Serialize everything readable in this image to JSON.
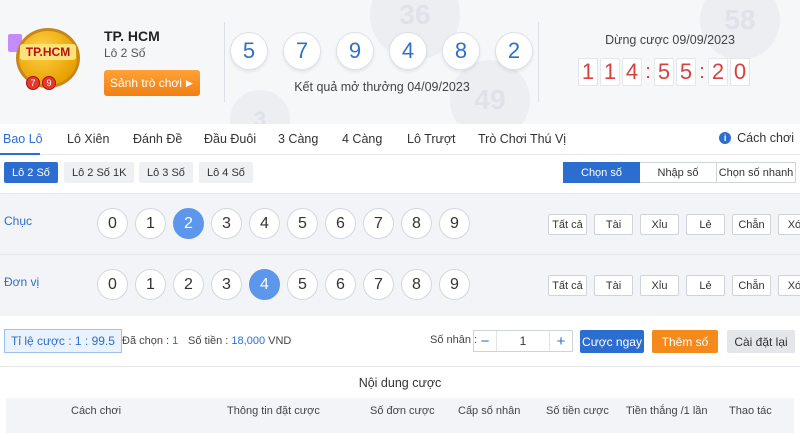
{
  "header": {
    "city": "TP. HCM",
    "game_type": "Lô 2 Số",
    "lobby_button": "Sảnh trò chơi",
    "logo_text": "TP.HCM",
    "logo_balls": [
      "7",
      "9"
    ],
    "result_numbers": [
      "5",
      "7",
      "9",
      "4",
      "8",
      "2"
    ],
    "result_caption": "Kết quả mở thưởng 04/09/2023",
    "deadline": "Dừng cược 09/09/2023",
    "countdown": [
      "1",
      "1",
      "4",
      ":",
      "5",
      "5",
      ":",
      "2",
      "0"
    ],
    "decor_numbers": [
      "36",
      "58",
      "49",
      "3"
    ]
  },
  "tabs": {
    "items": [
      "Bao Lô",
      "Lô Xiên",
      "Đánh Đề",
      "Đầu Đuôi",
      "3 Càng",
      "4 Càng",
      "Lô Trượt",
      "Trò Chơi Thú Vị"
    ],
    "active": "Bao Lô",
    "howto": "Cách chơi"
  },
  "subtabs": {
    "items": [
      "Lô 2 Số",
      "Lô 2 Số 1K",
      "Lô 3 Số",
      "Lô 4 Số"
    ],
    "active": "Lô 2 Số",
    "modes": [
      "Chọn số",
      "Nhập số",
      "Chọn số nhanh"
    ],
    "active_mode": "Chọn số"
  },
  "rows": [
    {
      "label": "Chục",
      "selected": "2"
    },
    {
      "label": "Đơn vị",
      "selected": "4"
    }
  ],
  "digits": [
    "0",
    "1",
    "2",
    "3",
    "4",
    "5",
    "6",
    "7",
    "8",
    "9"
  ],
  "quick_buttons": [
    "Tất cả",
    "Tài",
    "Xỉu",
    "Lẻ",
    "Chẵn",
    "Xóa"
  ],
  "bar": {
    "rate": "Tỉ lệ cược : 1 : 99.5",
    "selected_label": "Đã chọn :",
    "selected_value": "1",
    "amount_label": "Số tiền :",
    "amount_value": "18,000",
    "amount_unit": "VND",
    "multiplier_label": "Số nhân :",
    "multiplier_value": "1",
    "bet_now": "Cược ngay",
    "add_number": "Thêm số",
    "reset": "Cài đặt lại"
  },
  "bet_table": {
    "title": "Nội dung cược",
    "columns": [
      "Cách chơi",
      "Thông tin đặt cược",
      "Số đơn cược",
      "Cấp số nhân",
      "Số tiền cược",
      "Tiền thắng /1 lần",
      "Thao tác"
    ]
  },
  "colors": {
    "accent": "#2b6ecf",
    "selected_ball": "#5c97eb",
    "orange": "#f48a1c",
    "countdown": "#d94040"
  }
}
